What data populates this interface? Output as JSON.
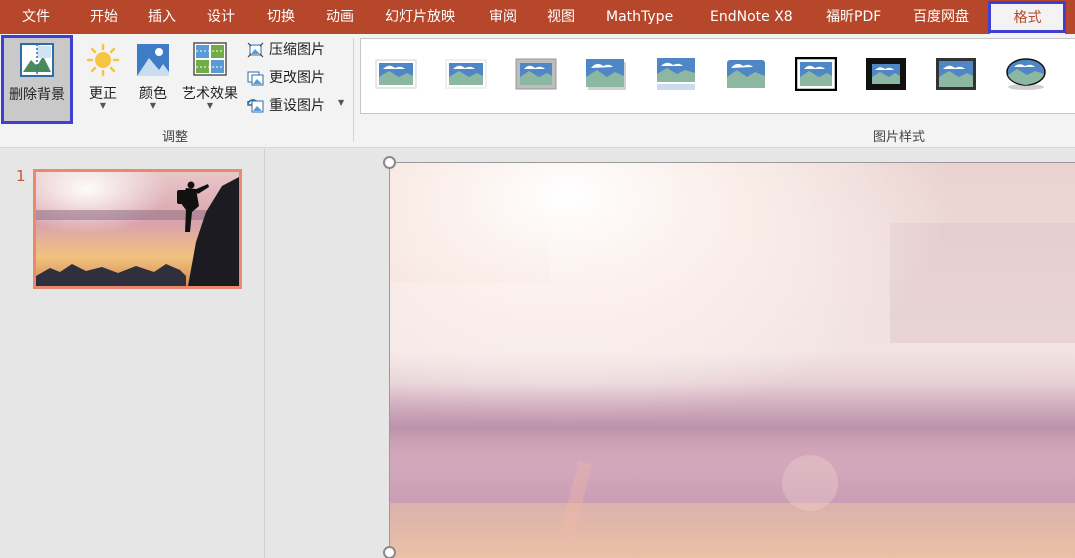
{
  "menu": {
    "items": [
      {
        "label": "文件"
      },
      {
        "label": "开始"
      },
      {
        "label": "插入"
      },
      {
        "label": "设计"
      },
      {
        "label": "切换"
      },
      {
        "label": "动画"
      },
      {
        "label": "幻灯片放映"
      },
      {
        "label": "审阅"
      },
      {
        "label": "视图"
      },
      {
        "label": "MathType"
      },
      {
        "label": "EndNote X8"
      },
      {
        "label": "福昕PDF"
      },
      {
        "label": "百度网盘"
      },
      {
        "label": "格式"
      }
    ],
    "active": "格式"
  },
  "ribbon": {
    "adjust": {
      "remove_bg": "删除背景",
      "correct": "更正",
      "color": "颜色",
      "art_effects": "艺术效果",
      "compress": "压缩图片",
      "change": "更改图片",
      "reset": "重设图片",
      "group_label": "调整"
    },
    "styles": {
      "group_label": "图片样式",
      "thumbnails": [
        "style-1",
        "style-2",
        "style-3",
        "style-4",
        "style-5",
        "style-6",
        "style-7",
        "style-8",
        "style-9",
        "style-10"
      ]
    }
  },
  "slides": {
    "number": "1"
  },
  "colors": {
    "menubar": "#b7472a",
    "highlight": "#3f3fd1",
    "selection": "#e88a6e"
  }
}
